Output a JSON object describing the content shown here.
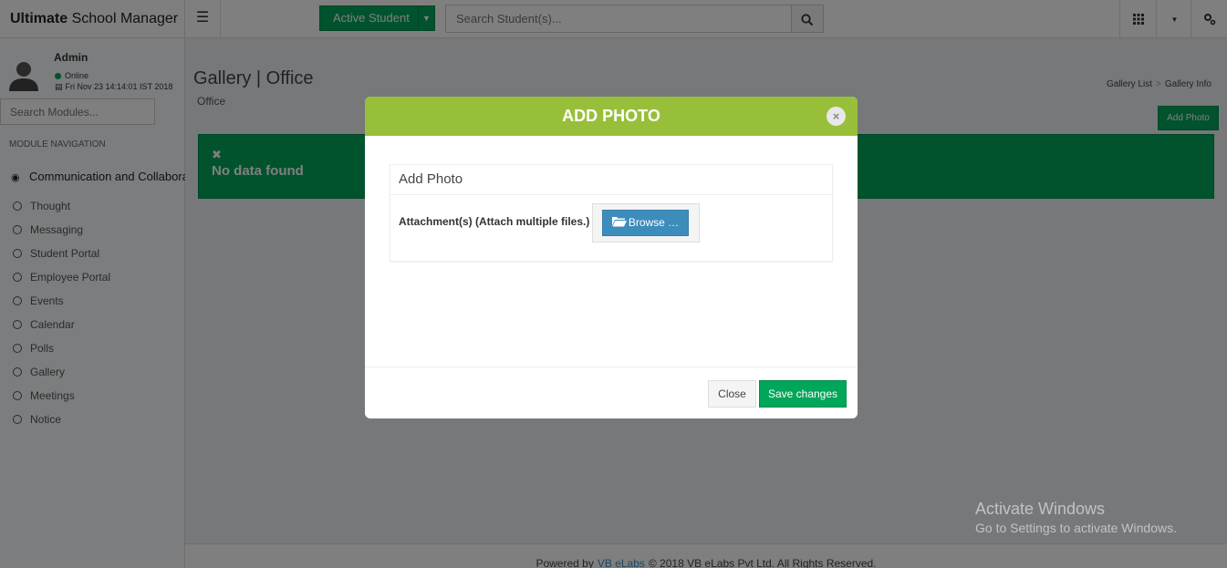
{
  "header": {
    "logo_bold": "Ultimate",
    "logo_rest": " School Manager",
    "active_student_label": "Active Student",
    "search_placeholder": "Search Student(s)..."
  },
  "sidebar": {
    "user_name": "Admin",
    "status": "Online",
    "datetime": "Fri Nov 23 14:14:01 IST 2018",
    "module_search_placeholder": "Search Modules...",
    "nav_header": "MODULE NAVIGATION",
    "parent_item": "Communication and Collaborat",
    "items": [
      {
        "label": "Thought"
      },
      {
        "label": "Messaging"
      },
      {
        "label": "Student Portal"
      },
      {
        "label": "Employee Portal"
      },
      {
        "label": "Events"
      },
      {
        "label": "Calendar"
      },
      {
        "label": "Polls"
      },
      {
        "label": "Gallery"
      },
      {
        "label": "Meetings"
      },
      {
        "label": "Notice"
      }
    ]
  },
  "content": {
    "page_title": "Gallery | Office",
    "page_subtitle": "Office",
    "breadcrumb": [
      "Gallery List",
      "Gallery Info"
    ],
    "add_photo_button": "Add Photo",
    "alert_message": "No data found"
  },
  "modal": {
    "title": "ADD PHOTO",
    "panel_title": "Add Photo",
    "attachment_label": "Attachment(s) (Attach multiple files.)",
    "browse_label": "Browse …",
    "close_label": "Close",
    "save_label": "Save changes"
  },
  "footer": {
    "prefix": "Powered by",
    "link": "VB eLabs",
    "suffix": "© 2018 VB eLabs Pvt Ltd. All Rights Reserved."
  },
  "watermark": {
    "line1": "Activate Windows",
    "line2": "Go to Settings to activate Windows."
  },
  "colors": {
    "accent_green": "#00a65a",
    "modal_header": "#98bf3a",
    "link_blue": "#3c8dbc"
  },
  "icons": [
    "hamburger-icon",
    "search-icon",
    "apps-grid-icon",
    "caret-down-icon",
    "settings-cog-icon",
    "user-avatar-icon",
    "calendar-icon",
    "dashboard-icon",
    "circle-icon",
    "close-icon",
    "folder-open-icon"
  ]
}
